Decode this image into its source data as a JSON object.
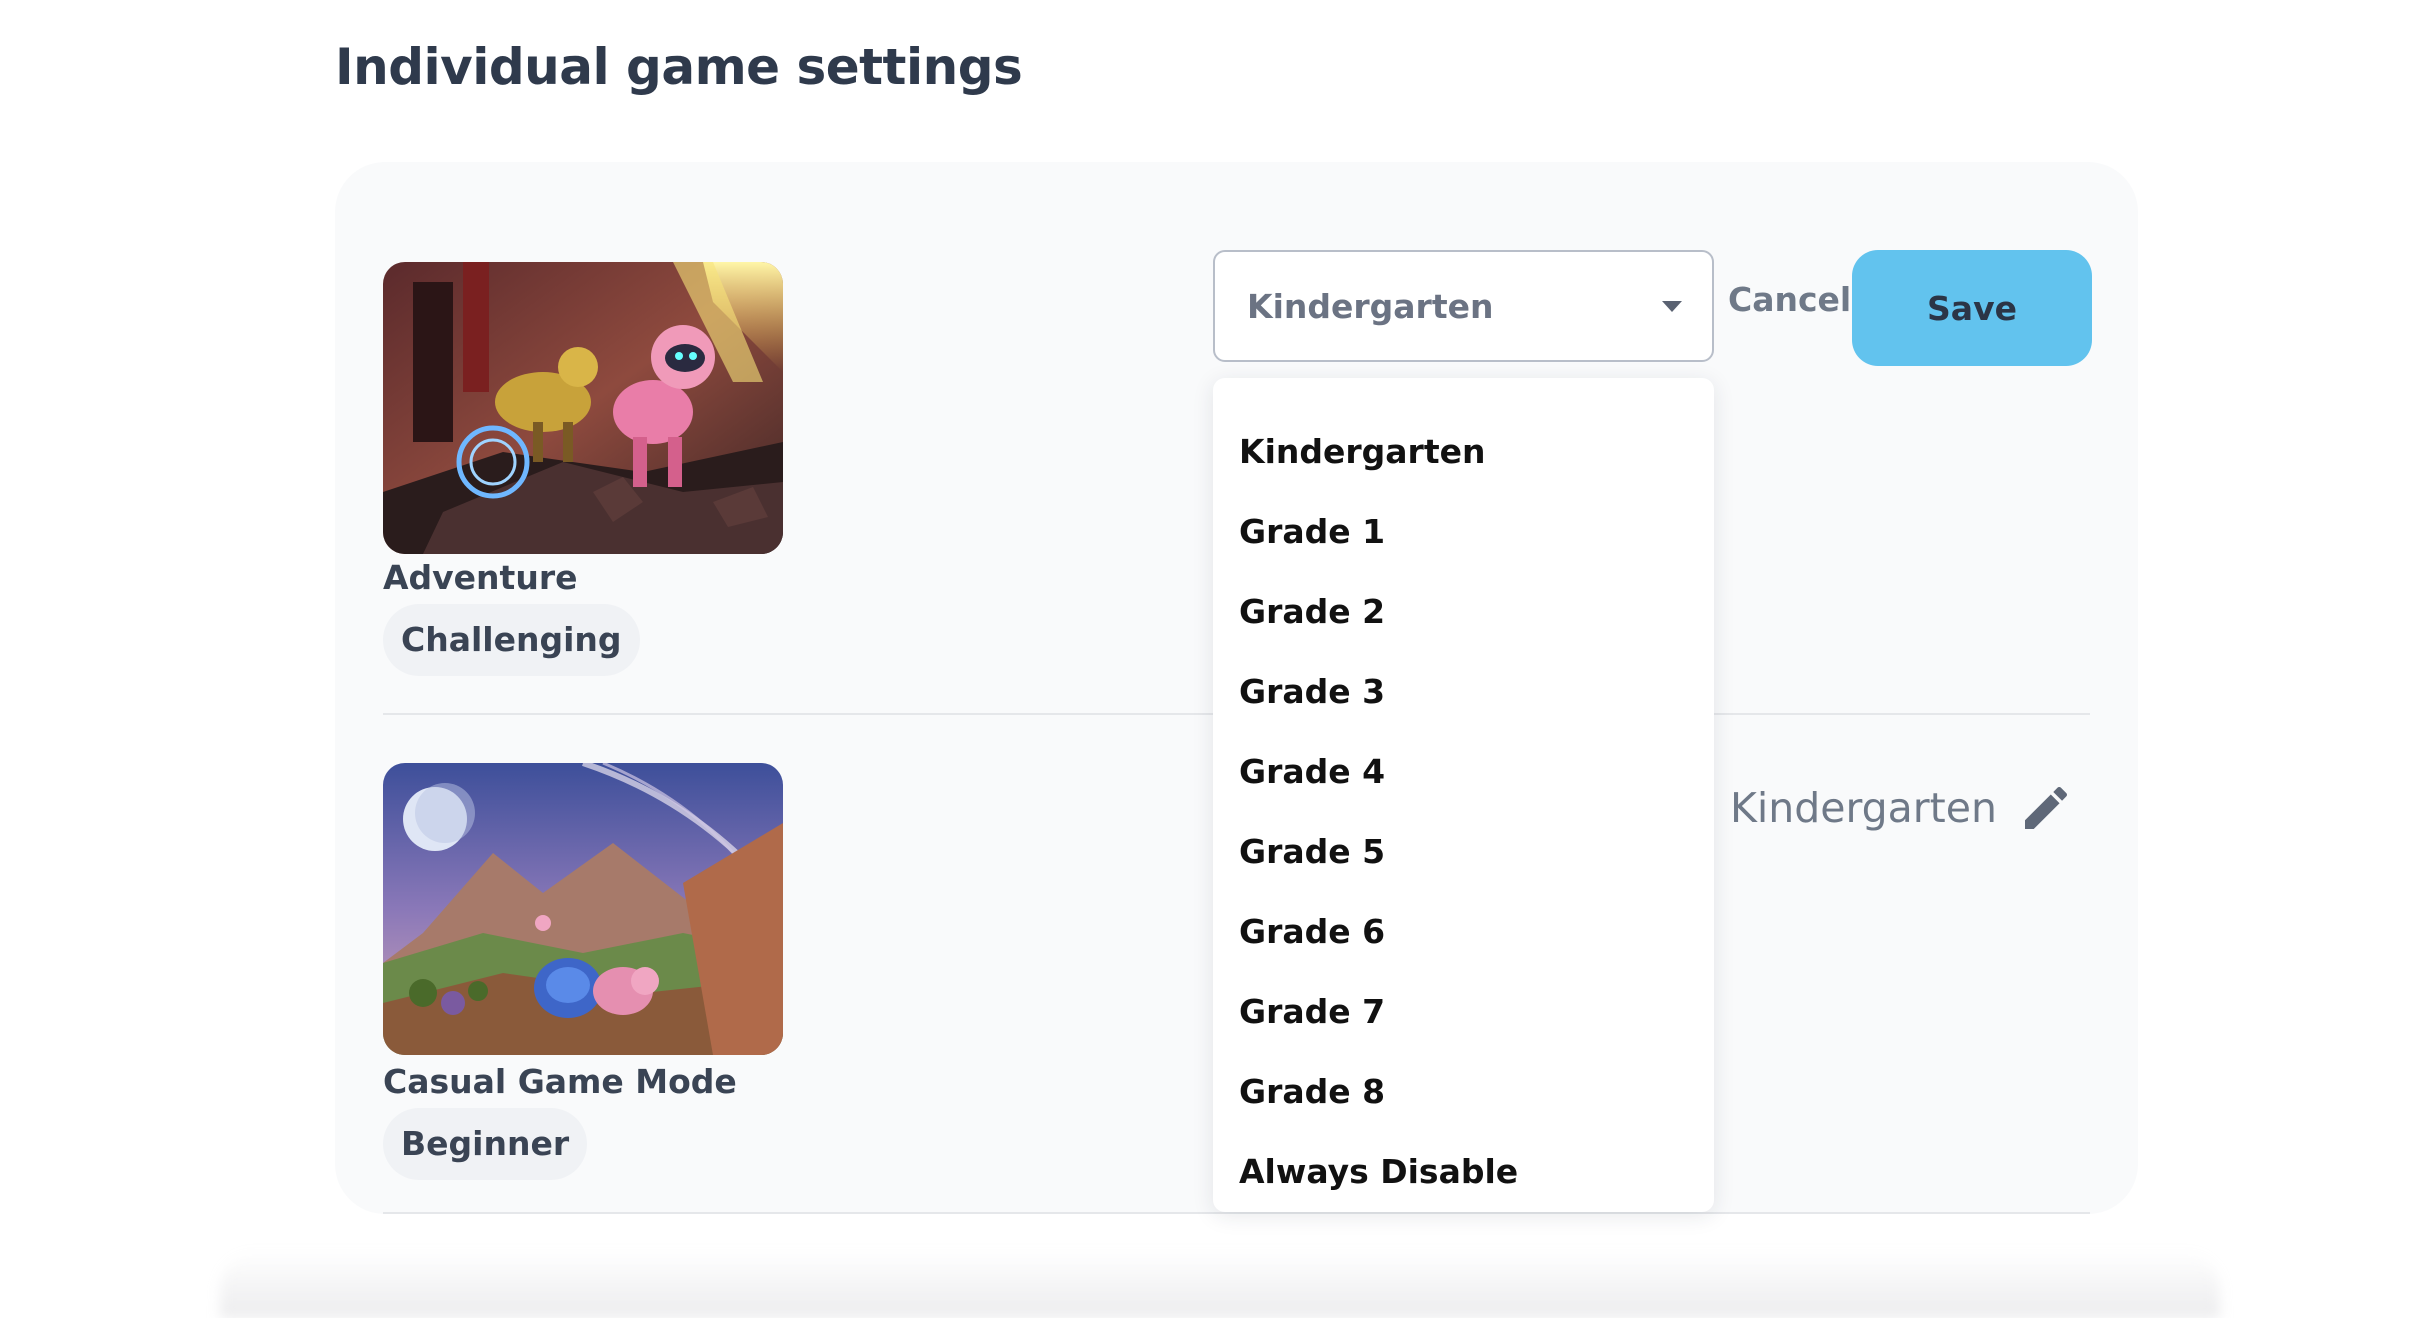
{
  "page": {
    "title": "Individual game settings"
  },
  "games": [
    {
      "name": "Adventure",
      "difficulty": "Challenging",
      "thumbnail": "adventure-game-artwork",
      "editing": true
    },
    {
      "name": "Casual Game Mode",
      "difficulty": "Beginner",
      "thumbnail": "casual-game-artwork",
      "grade": "Kindergarten",
      "edit_icon": "pencil-icon"
    }
  ],
  "editor": {
    "selected": "Kindergarten",
    "cancel_label": "Cancel",
    "save_label": "Save",
    "options": [
      "Kindergarten",
      "Grade 1",
      "Grade 2",
      "Grade 3",
      "Grade 4",
      "Grade 5",
      "Grade 6",
      "Grade 7",
      "Grade 8",
      "Always Disable"
    ]
  },
  "colors": {
    "save_button": "#62c3ee",
    "panel_background": "#f9fafb",
    "title_text": "#2f3a4c"
  }
}
